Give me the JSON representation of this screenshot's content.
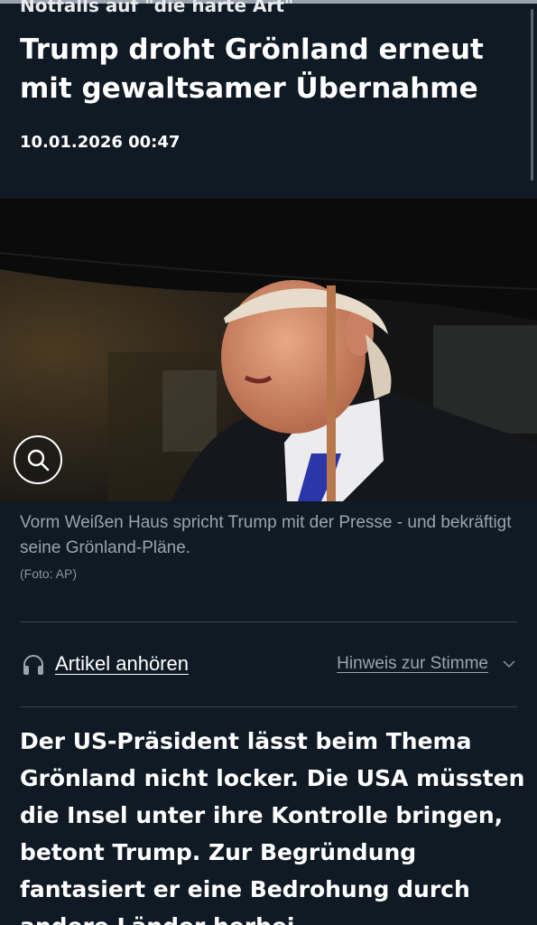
{
  "article": {
    "kicker": "Notfalls auf \"die harte Art\"",
    "headline": "Trump droht Grönland erneut mit gewaltsamer Übernahme",
    "date": "10.01.2026 00:47"
  },
  "image": {
    "caption": "Vorm Weißen Haus spricht Trump mit der Presse - und bekräftigt seine Grönland-Pläne.",
    "credit": "(Foto: AP)",
    "zoom_icon": "magnifier-icon"
  },
  "audio": {
    "icon": "headphones-icon",
    "listen_label": "Artikel anhören",
    "voice_note_label": "Hinweis zur Stimme",
    "dropdown_icon": "chevron-down-icon"
  },
  "lead": {
    "text": "Der US-Präsident lässt beim Thema Grönland nicht locker. Die USA müssten die Insel unter ihre Kontrolle bringen, betont Trump. Zur Begründung fantasiert er eine Bedrohung durch andere Länder herbei."
  },
  "colors": {
    "background": "#0f1a24",
    "text_primary": "#ffffff",
    "text_secondary": "#9aa4ad",
    "divider": "#34404b"
  }
}
